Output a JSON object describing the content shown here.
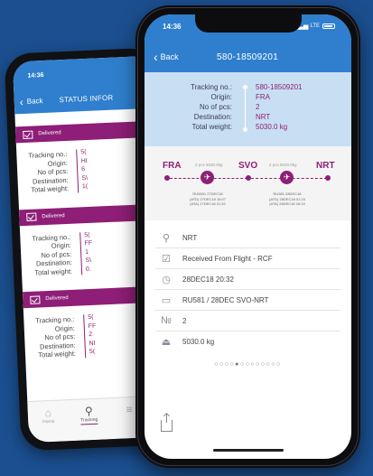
{
  "back_phone": {
    "time": "14:36",
    "back_label": "Back",
    "title": "STATUS INFOR",
    "labels": [
      "Tracking no.:",
      "Origin:",
      "No of pcs:",
      "Destination:",
      "Total weight:"
    ],
    "cards": [
      {
        "status": "Delivered",
        "values": [
          "5(",
          "HI",
          "6",
          "S\\",
          "1("
        ]
      },
      {
        "status": "Delivered",
        "values": [
          "5(",
          "FF",
          "1",
          "S\\",
          "0."
        ]
      },
      {
        "status": "Delivered",
        "values": [
          "5(",
          "FF",
          "2",
          "NI",
          "5("
        ]
      }
    ],
    "tabs": [
      {
        "label": "Home",
        "icon": "home-icon"
      },
      {
        "label": "Tracking",
        "icon": "search-icon"
      },
      {
        "label": "",
        "icon": "more-icon"
      }
    ]
  },
  "front_phone": {
    "time": "14:36",
    "network": "LTE",
    "back_label": "Back",
    "title": "580-18509201",
    "info": [
      {
        "label": "Tracking no.:",
        "value": "580-18509201"
      },
      {
        "label": "Origin:",
        "value": "FRA"
      },
      {
        "label": "No of pcs:",
        "value": "2"
      },
      {
        "label": "Destination:",
        "value": "NRT"
      },
      {
        "label": "Total weight:",
        "value": "5030.0 kg"
      }
    ],
    "route": {
      "from": "FRA",
      "via": "SVO",
      "to": "NRT",
      "leg1_weight": "2 pcs 5030.0kg",
      "leg2_weight": "2 pcs 5030.0kg",
      "leg1_details": [
        "RU5591 27DEC18",
        "(ATD) 27DEC18 15:07",
        "(ATA) 27DEC18 21:32"
      ],
      "leg2_details": [
        "RU581 28DEC18",
        "(ATD) 28DEC18 01:24",
        "(ATA) 28DEC18 16:19"
      ]
    },
    "events": [
      {
        "icon": "location-pin-icon",
        "text": "NRT"
      },
      {
        "icon": "checkbox-icon",
        "text": "Received From Flight - RCF"
      },
      {
        "icon": "clock-icon",
        "text": "28DEC18 20:32"
      },
      {
        "icon": "flight-icon",
        "text": "RU581 / 28DEC SVO-NRT"
      },
      {
        "icon": "number-icon",
        "text": "2"
      },
      {
        "icon": "weight-icon",
        "text": "5030.0 kg"
      }
    ],
    "page_dots": "○○○○●○○○○○○○○",
    "colors": {
      "accent": "#8e1e77",
      "header": "#2f7fce",
      "info_bg": "#c8dff3",
      "background": "#1b4f8f"
    }
  }
}
